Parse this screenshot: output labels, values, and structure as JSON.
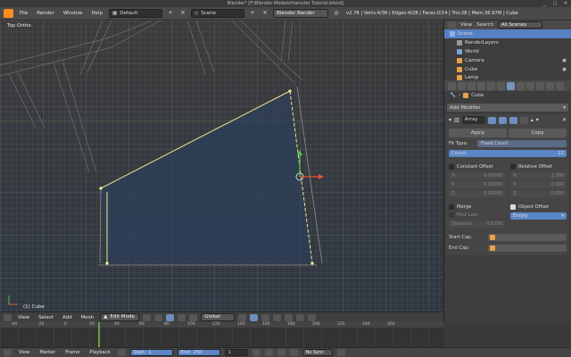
{
  "window": {
    "title": "Blender* [F:\\Blender Models\\Hamster Tutorial.blend]",
    "controls": [
      "_",
      "□",
      "✕"
    ]
  },
  "info": {
    "menus": [
      "File",
      "Render",
      "Window",
      "Help"
    ],
    "screen_layout": "Default",
    "scene": "Scene",
    "render_engine": "Blender Render",
    "stats": "v2.76 | Verts:4/36 | Edges:4/28 | Faces:0/14 | Tris:28 | Mem:36.97M | Cube"
  },
  "viewport": {
    "view_label": "Top Ortho",
    "object_label": "(1) Cube"
  },
  "view3d_header": {
    "menus": [
      "View",
      "Select",
      "Add",
      "Mesh"
    ],
    "mode": "Edit Mode",
    "orientation": "Global"
  },
  "outliner": {
    "menus": [
      "View",
      "Search"
    ],
    "filter": "All Scenes",
    "rows": [
      {
        "label": "Scene",
        "color": "#8fb0e8"
      },
      {
        "label": "RenderLayers",
        "color": "#9a9a9a"
      },
      {
        "label": "World",
        "color": "#7aa4d8"
      },
      {
        "label": "Camera",
        "color": "#e8a24a"
      },
      {
        "label": "Cube",
        "color": "#e8a24a"
      },
      {
        "label": "Lamp",
        "color": "#e8a24a"
      }
    ]
  },
  "properties": {
    "breadcrumb": "Cube",
    "add_modifier": "Add Modifier",
    "modifier_name": "Array",
    "apply_label": "Apply",
    "copy_label": "Copy",
    "fit_type_label": "Fit Type:",
    "fit_type_value": "Fixed Count",
    "count_label": "Count:",
    "count_value": "22",
    "constant_offset_label": "Constant Offset",
    "relative_offset_label": "Relative Offset",
    "const_fields": [
      {
        "axis": "X:",
        "value": "0.00000"
      },
      {
        "axis": "Y:",
        "value": "0.00000"
      },
      {
        "axis": "Z:",
        "value": "0.00000"
      }
    ],
    "rel_fields": [
      {
        "axis": "X:",
        "value": "1.000"
      },
      {
        "axis": "Y:",
        "value": "0.000"
      },
      {
        "axis": "Z:",
        "value": "0.000"
      }
    ],
    "merge_label": "Merge",
    "first_last_label": "First Last",
    "distance_label": "Distance:",
    "distance_value": "0.0100",
    "object_offset_label": "Object Offset",
    "object_offset_value": "Empty",
    "start_cap_label": "Start Cap:",
    "end_cap_label": "End Cap:"
  },
  "timeline": {
    "ticks": [
      "-40",
      "-20",
      "0",
      "20",
      "40",
      "60",
      "80",
      "100",
      "120",
      "140",
      "160",
      "180",
      "200",
      "220",
      "240",
      "260"
    ],
    "menus": [
      "View",
      "Marker",
      "Frame",
      "Playback"
    ],
    "start_label": "Start:",
    "start_value": "1",
    "end_label": "End:",
    "end_value": "250",
    "current_frame": "1",
    "sync": "No Sync"
  },
  "colors": {
    "accent": "#5680c2",
    "selection_edge": "#e8e890",
    "face_fill": "#2d3f5a",
    "y_axis": "#4fc24f",
    "x_axis": "#e0542e"
  },
  "icons": [
    "blender-logo-icon",
    "3d-cursor-icon",
    "translate-gizmo-icon",
    "modifier-wrench-icon",
    "camera-icon",
    "lamp-icon",
    "mesh-icon"
  ]
}
